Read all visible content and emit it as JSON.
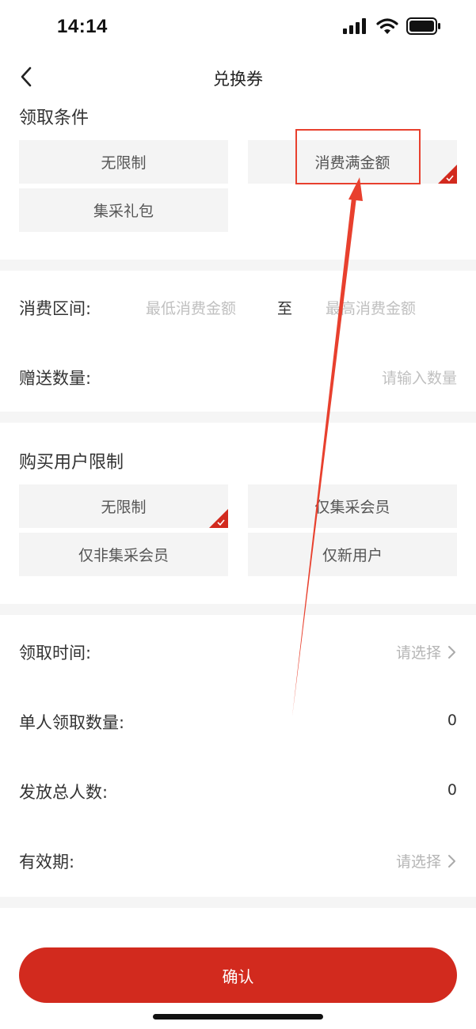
{
  "status_bar": {
    "time": "14:14"
  },
  "nav": {
    "title": "兑换券"
  },
  "claim_condition": {
    "title": "领取条件",
    "options": [
      {
        "label": "无限制",
        "selected": false
      },
      {
        "label": "消费满金额",
        "selected": true
      },
      {
        "label": "集采礼包",
        "selected": false
      }
    ]
  },
  "spend": {
    "range_label": "消费区间:",
    "min_placeholder": "最低消费金额",
    "to_text": "至",
    "max_placeholder": "最高消费金额",
    "gift_label": "赠送数量:",
    "gift_placeholder": "请输入数量"
  },
  "user_limit": {
    "title": "购买用户限制",
    "options": [
      {
        "label": "无限制",
        "selected": true
      },
      {
        "label": "仅集采会员",
        "selected": false
      },
      {
        "label": "仅非集采会员",
        "selected": false
      },
      {
        "label": "仅新用户",
        "selected": false
      }
    ]
  },
  "settings": {
    "claim_time_label": "领取时间:",
    "claim_time_value": "请选择",
    "per_person_label": "单人领取数量:",
    "per_person_value": "0",
    "total_people_label": "发放总人数:",
    "total_people_value": "0",
    "validity_label": "有效期:",
    "validity_value": "请选择"
  },
  "confirm": {
    "label": "确认"
  },
  "colors": {
    "accent": "#d22a1e",
    "annotation": "#e8402e"
  }
}
